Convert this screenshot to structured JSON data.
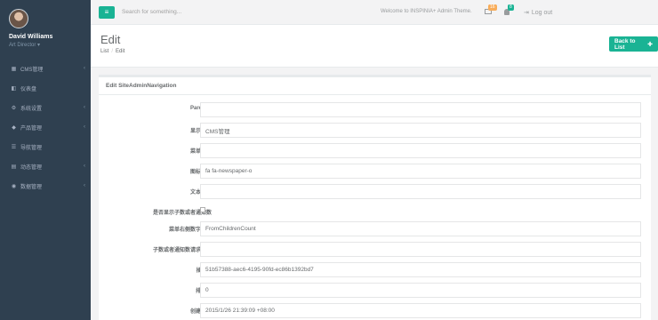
{
  "profile": {
    "name": "David Williams",
    "role": "Art Director"
  },
  "sidebar": {
    "items": [
      {
        "label": "CMS管理",
        "icon": "th-large-icon",
        "glyph": "▦",
        "has_arrow": true
      },
      {
        "label": "仪表盘",
        "icon": "dashboard-icon",
        "glyph": "◧",
        "has_arrow": false
      },
      {
        "label": "系统设置",
        "icon": "gear-icon",
        "glyph": "⚙",
        "has_arrow": true
      },
      {
        "label": "产品管理",
        "icon": "tag-icon",
        "glyph": "◆",
        "has_arrow": true
      },
      {
        "label": "导航管理",
        "icon": "list-icon",
        "glyph": "☰",
        "has_arrow": false
      },
      {
        "label": "动态管理",
        "icon": "newspaper-icon",
        "glyph": "▤",
        "has_arrow": true
      },
      {
        "label": "数据管理",
        "icon": "database-icon",
        "glyph": "◉",
        "has_arrow": true
      }
    ]
  },
  "topbar": {
    "menu_glyph": "≡",
    "search_placeholder": "Search for something...",
    "welcome": "Welcome to INSPINIA+ Admin Theme.",
    "mail_count": "16",
    "alert_count": "8",
    "logout": "Log out",
    "logout_glyph": "⇥"
  },
  "heading": {
    "title": "Edit",
    "breadcrumb": {
      "item1": "List",
      "separator": "/",
      "item2": "Edit"
    },
    "back_label": "Back to List",
    "back_glyph": "✚"
  },
  "panel": {
    "title": "Edit SiteAdminNavigation",
    "fields": [
      {
        "label": "ParentId",
        "value": ""
      },
      {
        "label": "显示文本",
        "value": "CMS管理"
      },
      {
        "label": "菜单链接",
        "value": ""
      },
      {
        "label": "图标样式",
        "value": "fa fa-newspaper-o"
      },
      {
        "label": "文本样式",
        "value": ""
      },
      {
        "label": "是否显示子数或者通知数",
        "value": "",
        "checkbox": true
      },
      {
        "label": "菜单右侧数字类型",
        "value": "FromChildrenCount"
      },
      {
        "label": "子数或者通知数请求地址",
        "value": ""
      },
      {
        "label": "插件Id",
        "value": "51b57388-aec6-4195-90fd-ec86b1392bd7"
      },
      {
        "label": "排序号",
        "value": "0"
      },
      {
        "label": "创建时间",
        "value": "2015/1/26 21:39:09 +08:00"
      }
    ]
  },
  "colors": {
    "sidebar": "#2f4050",
    "primary": "#1ab394",
    "warning": "#f8ac59",
    "text": "#676a6c"
  }
}
